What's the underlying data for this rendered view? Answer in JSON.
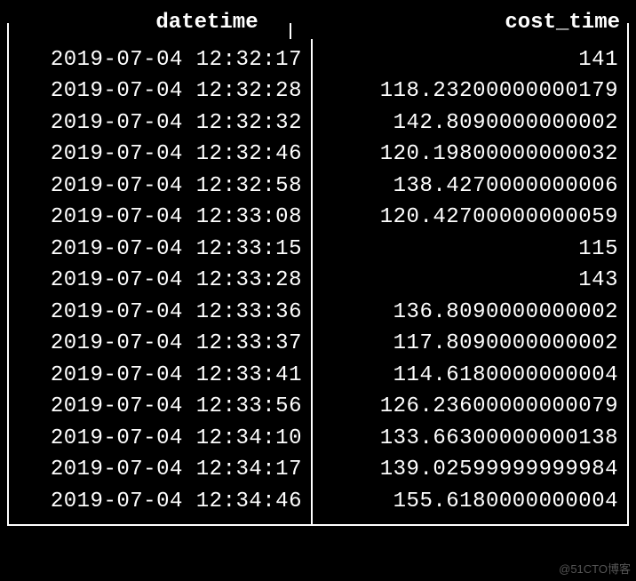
{
  "columns": {
    "datetime_header": "datetime",
    "cost_time_header": "cost_time"
  },
  "rows": [
    {
      "datetime": "2019-07-04 12:32:17",
      "cost_time": "141"
    },
    {
      "datetime": "2019-07-04 12:32:28",
      "cost_time": "118.23200000000179"
    },
    {
      "datetime": "2019-07-04 12:32:32",
      "cost_time": "142.8090000000002"
    },
    {
      "datetime": "2019-07-04 12:32:46",
      "cost_time": "120.19800000000032"
    },
    {
      "datetime": "2019-07-04 12:32:58",
      "cost_time": "138.4270000000006"
    },
    {
      "datetime": "2019-07-04 12:33:08",
      "cost_time": "120.42700000000059"
    },
    {
      "datetime": "2019-07-04 12:33:15",
      "cost_time": "115"
    },
    {
      "datetime": "2019-07-04 12:33:28",
      "cost_time": "143"
    },
    {
      "datetime": "2019-07-04 12:33:36",
      "cost_time": "136.8090000000002"
    },
    {
      "datetime": "2019-07-04 12:33:37",
      "cost_time": "117.8090000000002"
    },
    {
      "datetime": "2019-07-04 12:33:41",
      "cost_time": "114.6180000000004"
    },
    {
      "datetime": "2019-07-04 12:33:56",
      "cost_time": "126.23600000000079"
    },
    {
      "datetime": "2019-07-04 12:34:10",
      "cost_time": "133.66300000000138"
    },
    {
      "datetime": "2019-07-04 12:34:17",
      "cost_time": "139.02599999999984"
    },
    {
      "datetime": "2019-07-04 12:34:46",
      "cost_time": "155.6180000000004"
    }
  ],
  "watermark": "@51CTO博客"
}
